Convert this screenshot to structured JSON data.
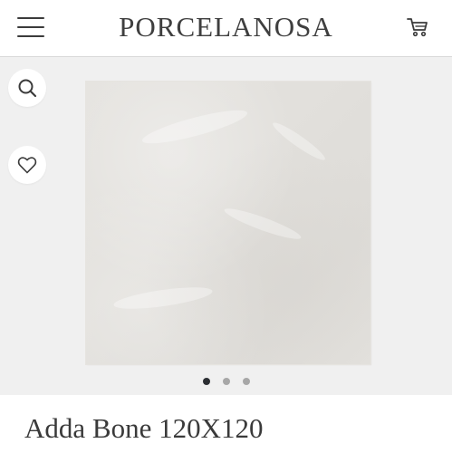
{
  "header": {
    "brand": "PORCELANOSA",
    "menu_icon": "hamburger-menu-icon",
    "cart_icon": "shopping-cart-icon"
  },
  "gallery": {
    "search_icon": "search-icon",
    "favorite_icon": "heart-icon",
    "image_count": 3,
    "active_index": 0
  },
  "product": {
    "title": "Adda Bone 120X120"
  },
  "colors": {
    "text": "#3a3a3a",
    "gallery_bg": "#f0f0f0",
    "dot_active": "#2c2f33",
    "dot_inactive": "#a7a7a7",
    "tile": "#e2e0dc"
  }
}
